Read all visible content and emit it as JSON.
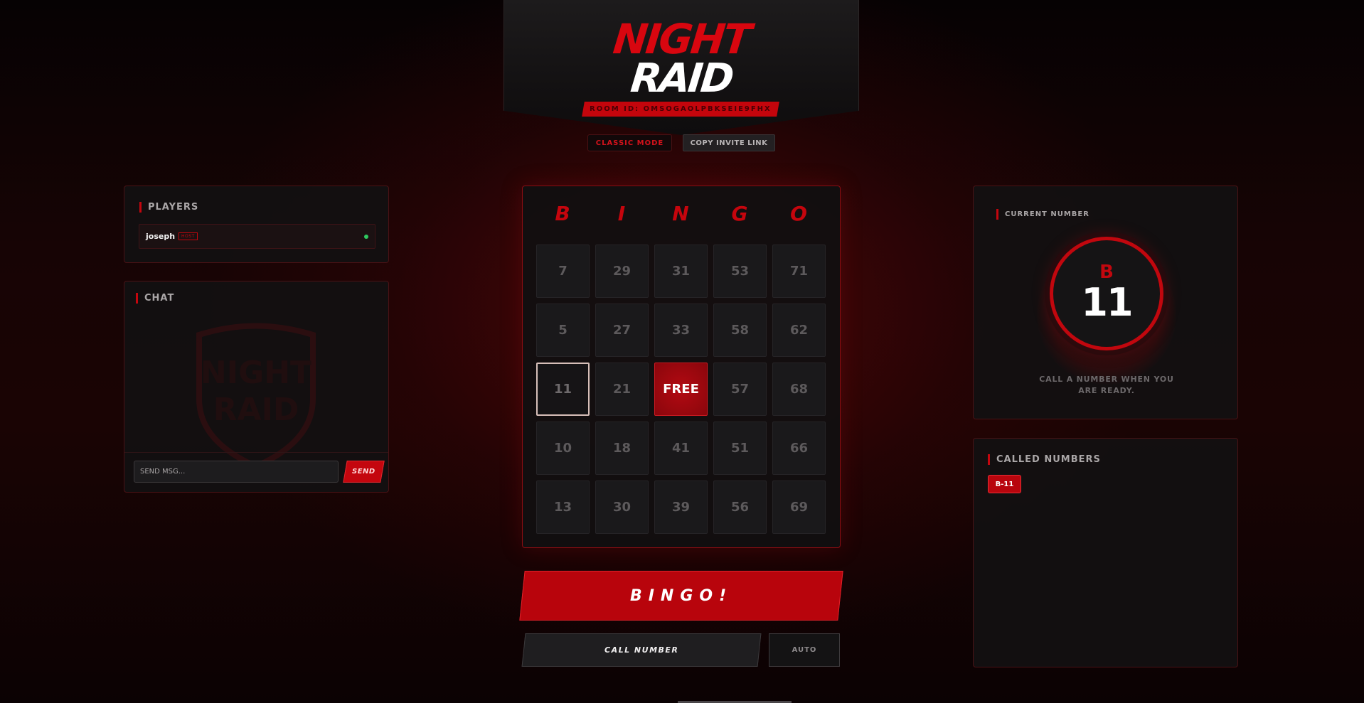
{
  "header": {
    "logo_line1": "NIGHT",
    "logo_line2": "RAID",
    "room_id": "ROOM ID: OMSOGAOLPBKSEIE9FHX"
  },
  "buttons": {
    "mode": "CLASSIC MODE",
    "invite": "COPY INVITE LINK",
    "bingo": "BINGO!",
    "call_number": "CALL NUMBER",
    "auto": "AUTO",
    "send": "SEND"
  },
  "players": {
    "title": "PLAYERS",
    "list": [
      {
        "name": "joseph",
        "badge": "HOST",
        "status": "online"
      }
    ]
  },
  "chat": {
    "title": "CHAT",
    "input_placeholder": "SEND MSG...",
    "watermark_line1": "NIGHT",
    "watermark_line2": "RAID"
  },
  "card": {
    "letters": [
      "B",
      "I",
      "N",
      "G",
      "O"
    ],
    "rows": [
      [
        "7",
        "29",
        "31",
        "53",
        "71"
      ],
      [
        "5",
        "27",
        "33",
        "58",
        "62"
      ],
      [
        "11",
        "21",
        "FREE",
        "57",
        "68"
      ],
      [
        "10",
        "18",
        "41",
        "51",
        "66"
      ],
      [
        "13",
        "30",
        "39",
        "56",
        "69"
      ]
    ],
    "marked": [
      "11"
    ],
    "free_label": "FREE"
  },
  "current": {
    "title": "CURRENT NUMBER",
    "letter": "B",
    "number": "11",
    "hint": "CALL A NUMBER WHEN YOU ARE READY."
  },
  "called": {
    "title": "CALLED NUMBERS",
    "numbers": [
      "B-11"
    ]
  },
  "colors": {
    "accent": "#c4060e",
    "background": "#120405",
    "panel": "#121011",
    "online": "#2ec95f"
  }
}
